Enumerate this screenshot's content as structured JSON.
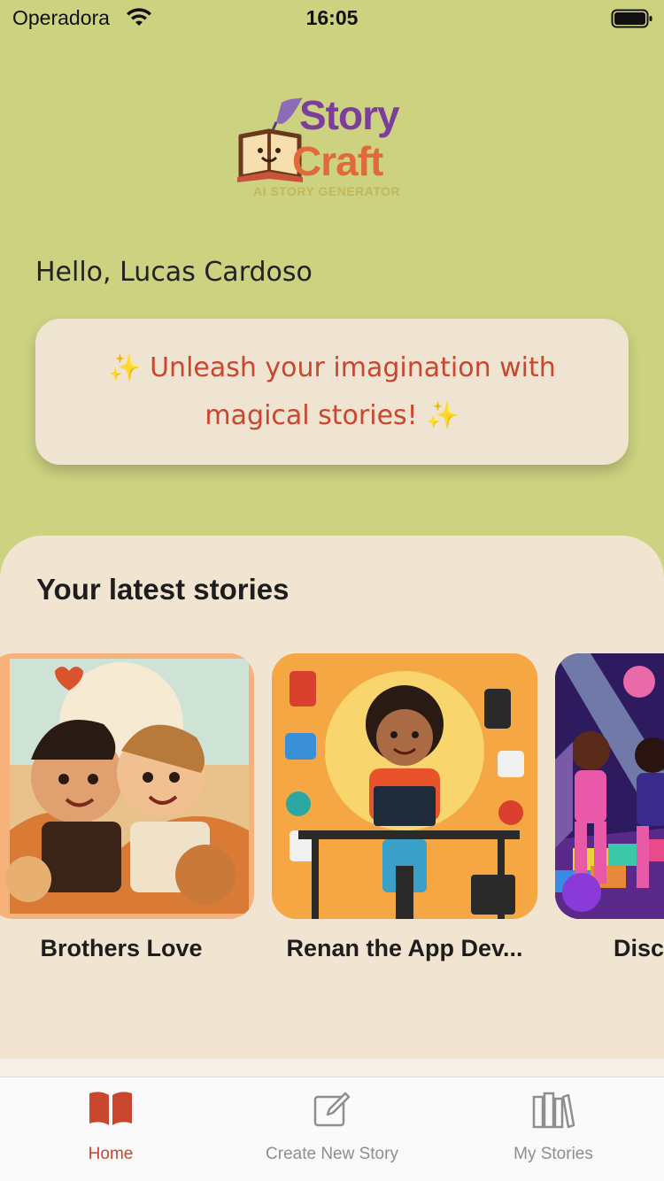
{
  "status": {
    "carrier": "Operadora",
    "time": "16:05"
  },
  "logo": {
    "line1": "Story",
    "line2": "Craft",
    "tagline": "AI STORY GENERATOR"
  },
  "greeting": "Hello, Lucas Cardoso",
  "banner": {
    "text": "✨ Unleash your imagination with magical stories! ✨"
  },
  "latest": {
    "title": "Your latest stories",
    "stories": [
      {
        "title": "Brothers Love"
      },
      {
        "title": "Renan the App Dev..."
      },
      {
        "title": "Disc"
      }
    ]
  },
  "tabs": [
    {
      "label": "Home",
      "icon": "book-open-icon"
    },
    {
      "label": "Create New Story",
      "icon": "edit-icon"
    },
    {
      "label": "My Stories",
      "icon": "books-icon"
    }
  ],
  "colors": {
    "background": "#ccd280",
    "accent": "#c8472e",
    "panel": "#f1e4d1",
    "tab_inactive": "#8e8e8e"
  }
}
